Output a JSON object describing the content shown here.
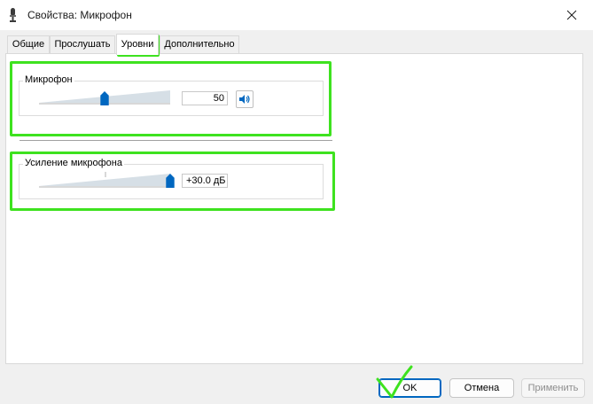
{
  "window": {
    "title": "Свойства: Микрофон",
    "icon": "microphone-icon",
    "close_icon": "close-icon"
  },
  "tabs": [
    {
      "label": "Общие",
      "active": false
    },
    {
      "label": "Прослушать",
      "active": false
    },
    {
      "label": "Уровни",
      "active": true
    },
    {
      "label": "Дополнительно",
      "active": false
    }
  ],
  "levels": {
    "microphone": {
      "label": "Микрофон",
      "value_text": "50",
      "level_fraction": 0.5,
      "mute_icon": "speaker-icon"
    },
    "boost": {
      "label": "Усиление микрофона",
      "value_text": "+30.0 дБ",
      "level_fraction": 1.0
    }
  },
  "buttons": {
    "ok": "OK",
    "cancel": "Отмена",
    "apply": "Применить"
  },
  "colors": {
    "highlight": "#3ee21f",
    "accent": "#0067c0",
    "thumb": "#0067c0"
  }
}
